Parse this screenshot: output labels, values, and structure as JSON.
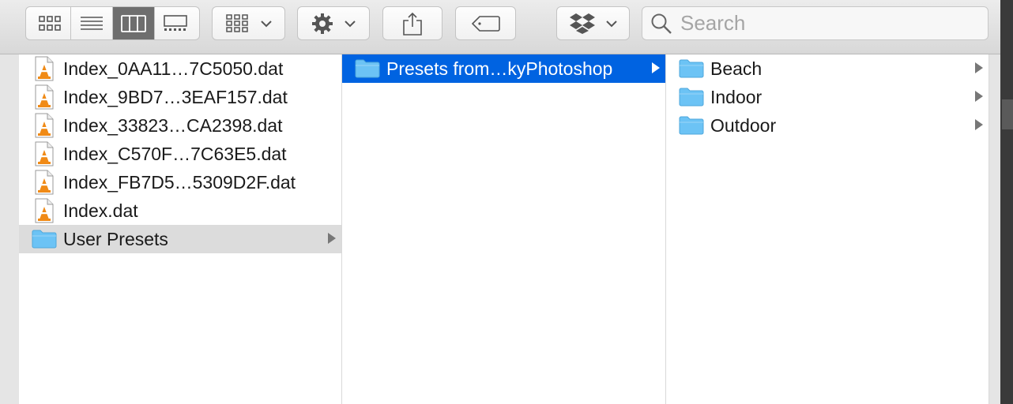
{
  "toolbar": {
    "view_modes": [
      "icon-view",
      "list-view",
      "column-view",
      "gallery-view"
    ],
    "active_view": "column-view"
  },
  "search": {
    "placeholder": "Search"
  },
  "columns": {
    "col1": [
      {
        "name": "Index_0AA11…7C5050.dat",
        "icon": "vlc-file-icon"
      },
      {
        "name": "Index_9BD7…3EAF157.dat",
        "icon": "vlc-file-icon"
      },
      {
        "name": "Index_33823…CA2398.dat",
        "icon": "vlc-file-icon"
      },
      {
        "name": "Index_C570F…7C63E5.dat",
        "icon": "vlc-file-icon"
      },
      {
        "name": "Index_FB7D5…5309D2F.dat",
        "icon": "vlc-file-icon"
      },
      {
        "name": "Index.dat",
        "icon": "vlc-file-icon"
      },
      {
        "name": "User Presets",
        "icon": "folder-icon",
        "selected": true
      }
    ],
    "col2": [
      {
        "name": "Presets from…kyPhotoshop",
        "icon": "folder-icon",
        "selected": true,
        "active": true
      }
    ],
    "col3": [
      {
        "name": "Beach",
        "icon": "folder-icon"
      },
      {
        "name": "Indoor",
        "icon": "folder-icon"
      },
      {
        "name": "Outdoor",
        "icon": "folder-icon"
      }
    ]
  },
  "colors": {
    "selection_active": "#0063e1",
    "selection_inactive": "#dcdcdc",
    "folder": "#6cc3f5"
  }
}
